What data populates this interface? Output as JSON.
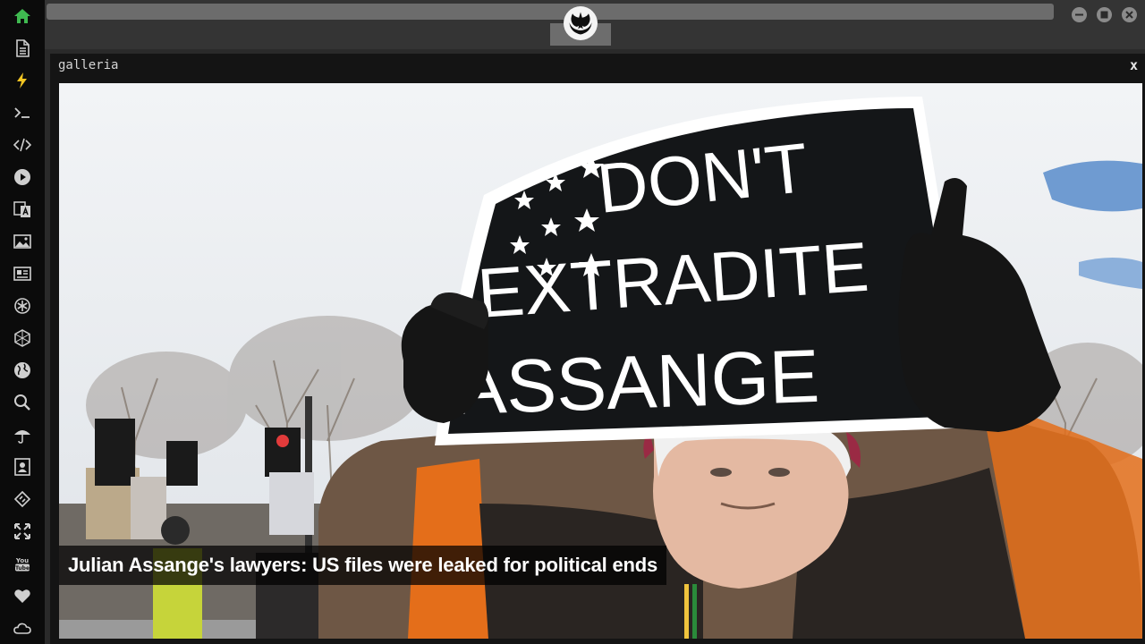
{
  "sidebar": {
    "items": [
      {
        "icon": "home-icon"
      },
      {
        "icon": "document-icon"
      },
      {
        "icon": "lightning-icon"
      },
      {
        "icon": "terminal-icon"
      },
      {
        "icon": "code-icon"
      },
      {
        "icon": "play-icon"
      },
      {
        "icon": "translate-icon"
      },
      {
        "icon": "image-icon"
      },
      {
        "icon": "news-icon"
      },
      {
        "icon": "settings-icon"
      },
      {
        "icon": "hexagon-icon"
      },
      {
        "icon": "globe-icon"
      },
      {
        "icon": "search-icon"
      },
      {
        "icon": "umbrella-icon"
      },
      {
        "icon": "contact-icon"
      },
      {
        "icon": "embed-icon"
      },
      {
        "icon": "expand-icon"
      },
      {
        "icon": "youtube-icon"
      },
      {
        "icon": "heart-icon"
      },
      {
        "icon": "cloud-icon"
      }
    ],
    "active_color": "#3fb950",
    "accent_color": "#f3c623"
  },
  "topbar": {
    "emblem": "rebel-alliance-icon",
    "window_buttons": [
      "minimize-icon",
      "maximize-icon",
      "close-icon"
    ]
  },
  "window": {
    "title": "galleria",
    "close_label": "x"
  },
  "gallery": {
    "sign_line1": "DON'T",
    "sign_line2": "EXTRADITE",
    "sign_line3": "ASSANGE",
    "caption": "Julian Assange's lawyers: US files were leaked for political ends"
  }
}
